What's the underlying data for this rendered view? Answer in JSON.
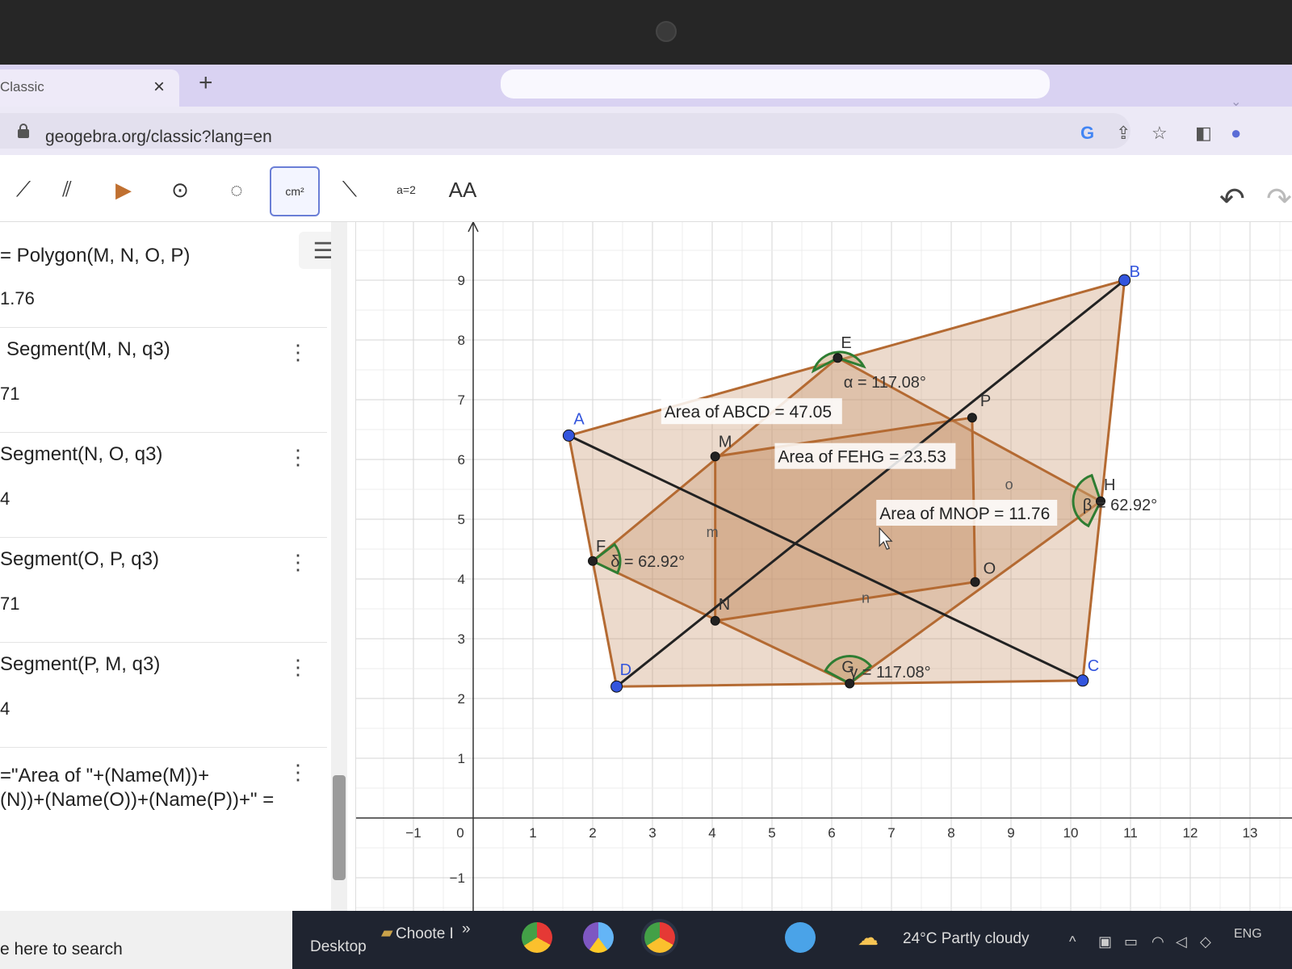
{
  "browser": {
    "tab_title": "Classic",
    "tab_close": "×",
    "new_tab": "+",
    "url": "geogebra.org/classic?lang=en",
    "addr_icons": [
      "google-icon",
      "share-icon",
      "star-icon",
      "sidepanel-icon",
      "profile-icon"
    ]
  },
  "toolbar": {
    "tools": [
      {
        "name": "line-tool-icon",
        "glyph": "⟋"
      },
      {
        "name": "parallel-tool-icon",
        "glyph": "⫽"
      },
      {
        "name": "polygon-tool-icon",
        "glyph": "▶"
      },
      {
        "name": "circle-tool-icon",
        "glyph": "⊙"
      },
      {
        "name": "circle-three-points-tool-icon",
        "glyph": "◌"
      },
      {
        "name": "area-tool-icon",
        "glyph": "cm²"
      },
      {
        "name": "reflect-tool-icon",
        "glyph": "⟍"
      },
      {
        "name": "slider-tool-icon",
        "glyph": "a=2"
      },
      {
        "name": "text-tool-icon",
        "glyph": "AA"
      }
    ],
    "undo": "↶",
    "redo": "↷"
  },
  "algebra": {
    "menu_icon": "☰",
    "items": [
      {
        "definition": "= Polygon(M, N, O, P)",
        "value": "1.76"
      },
      {
        "definition": "Segment(M, N, q3)",
        "value": "71"
      },
      {
        "definition": "Segment(N, O, q3)",
        "value": "4"
      },
      {
        "definition": "Segment(O, P, q3)",
        "value": "71"
      },
      {
        "definition": "Segment(P, M, q3)",
        "value": "4"
      },
      {
        "definition": "=\"Area of \"+(Name(M))+",
        "value": "(N))+(Name(O))+(Name(P))+\" ="
      }
    ],
    "dots": "⋮"
  },
  "graphics": {
    "x_ticks": [
      "−1",
      "0",
      "1",
      "2",
      "3",
      "4",
      "5",
      "6",
      "7",
      "8",
      "9",
      "10",
      "11",
      "12",
      "13"
    ],
    "y_ticks": [
      "−1",
      "1",
      "2",
      "3",
      "4",
      "5",
      "6",
      "7",
      "8",
      "9"
    ],
    "point_labels": [
      "A",
      "B",
      "C",
      "D",
      "E",
      "F",
      "G",
      "H",
      "M",
      "N",
      "O",
      "P"
    ],
    "segment_labels": [
      "m",
      "n",
      "o"
    ],
    "angle_labels": [
      "α = 117.08°",
      "β = 62.92°",
      "γ = 117.08°",
      "δ = 62.92°"
    ],
    "area_texts": [
      "Area of ABCD = 47.05",
      "Area of FEHG = 23.53",
      "Area of MNOP = 11.76"
    ],
    "colors": {
      "polygon": "#b46a32",
      "fill": "#c8966e",
      "free_point": "#3355dd",
      "angle": "#2e7d32"
    }
  },
  "taskbar": {
    "search_text": "e here to search",
    "desktop": "Desktop",
    "app_label": "Choote I",
    "overflow": "»",
    "weather": "24°C  Partly cloudy",
    "lang": "ENG",
    "tray_up": "^"
  }
}
